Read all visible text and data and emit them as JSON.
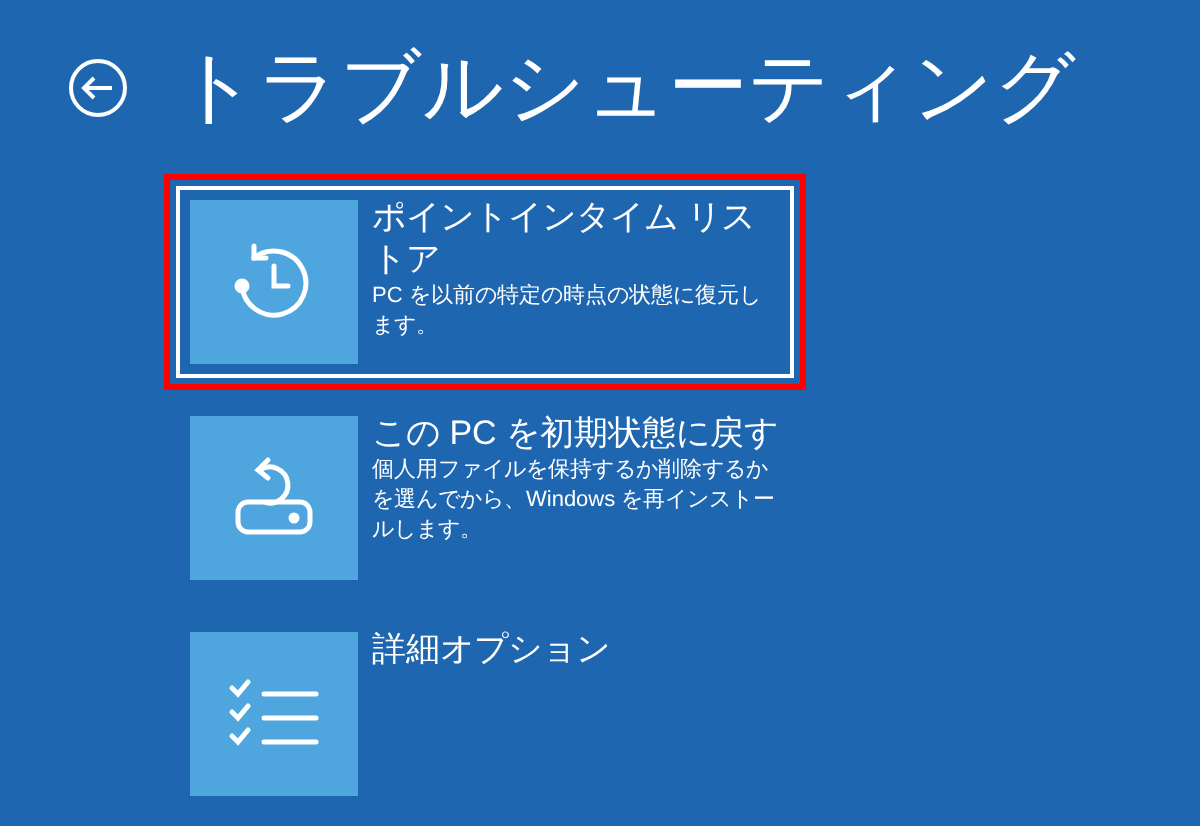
{
  "header": {
    "title": "トラブルシューティング"
  },
  "options": [
    {
      "kind": "restore",
      "title": "ポイントインタイム リストア",
      "description": "PC を以前の特定の時点の状態に復元します。",
      "selected": true,
      "highlighted": true
    },
    {
      "kind": "reset",
      "title": "この PC を初期状態に戻す",
      "description": "個人用ファイルを保持するか削除するかを選んでから、Windows を再インストールします。",
      "selected": false,
      "highlighted": false
    },
    {
      "kind": "advanced",
      "title": "詳細オプション",
      "selected": false,
      "highlighted": false
    }
  ]
}
